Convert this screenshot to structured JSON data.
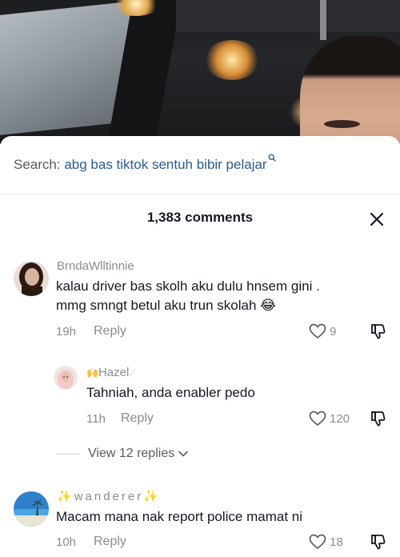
{
  "search": {
    "label": "Search:",
    "query": "abg bas tiktok sentuh bibir pelajar"
  },
  "header": {
    "comments_count": "1,383 comments"
  },
  "comments": [
    {
      "username": "BrndaWlltinnie",
      "text_line1": "kalau driver bas skolh aku dulu hnsem gini .",
      "text_line2": "mmg smngt betul aku trun skolah",
      "emoji": "😂",
      "time": "19h",
      "reply_label": "Reply",
      "likes": "9"
    },
    {
      "username": "Hazel",
      "text": "Tahniah, anda enabler pedo",
      "time": "11h",
      "reply_label": "Reply",
      "likes": "120"
    },
    {
      "username": "wanderer",
      "text": "Macam mana nak report police mamat ni",
      "time": "10h",
      "reply_label": "Reply",
      "likes": "18"
    }
  ],
  "view_replies": {
    "label": "View 12 replies"
  },
  "icons": {
    "search": "search-icon",
    "close": "close-icon",
    "like": "heart-icon",
    "dislike": "thumbs-down-icon",
    "chevron": "chevron-down-icon"
  }
}
